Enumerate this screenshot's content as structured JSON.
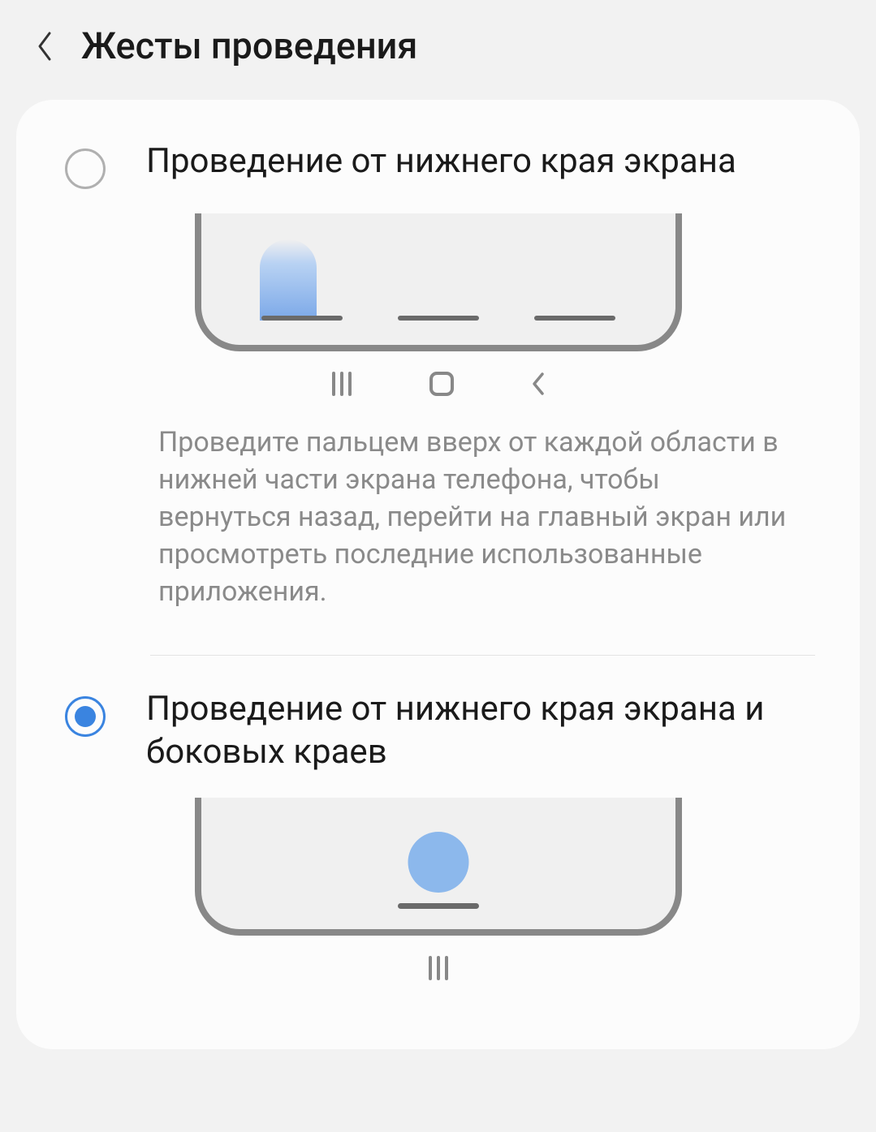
{
  "header": {
    "title": "Жесты проведения"
  },
  "options": [
    {
      "label": "Проведение от нижнего края экрана",
      "selected": false,
      "description": "Проведите пальцем вверх от каждой области в нижней части экрана телефона, чтобы вернуться назад, перейти на главный экран или просмотреть последние использованные приложения."
    },
    {
      "label": "Проведение от нижнего края экрана и боковых краев",
      "selected": true
    }
  ]
}
